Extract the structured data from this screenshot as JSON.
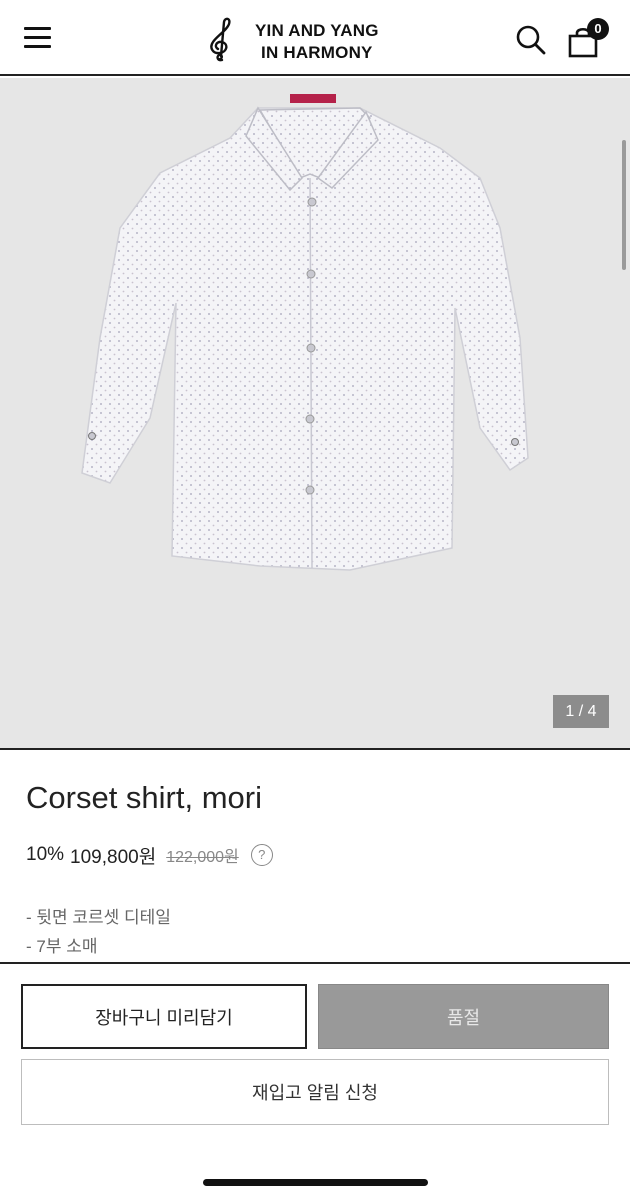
{
  "header": {
    "logo_line1": "YIN AND YANG",
    "logo_line2": "IN HARMONY",
    "cart_count": "0",
    "menu_icon": "hamburger-menu-icon",
    "search_icon": "search-icon",
    "cart_icon": "shopping-bag-icon"
  },
  "gallery": {
    "counter": "1 / 4",
    "product_image": "white patterned shirt"
  },
  "product": {
    "title": "Corset shirt, mori",
    "discount": "10%",
    "price": "109,800원",
    "original_price": "122,000원",
    "help_label": "?",
    "description": [
      "- 뒷면 코르셋 디테일",
      "- 7부 소매"
    ]
  },
  "actions": {
    "cart_label": "장바구니 미리담기",
    "soldout_label": "품절",
    "restock_label": "재입고 알림 신청"
  },
  "colors": {
    "accent": "#222222",
    "soldout_bg": "#999999",
    "gallery_bg": "#e6e6e6",
    "counter_bg": "#8c8c8c"
  }
}
